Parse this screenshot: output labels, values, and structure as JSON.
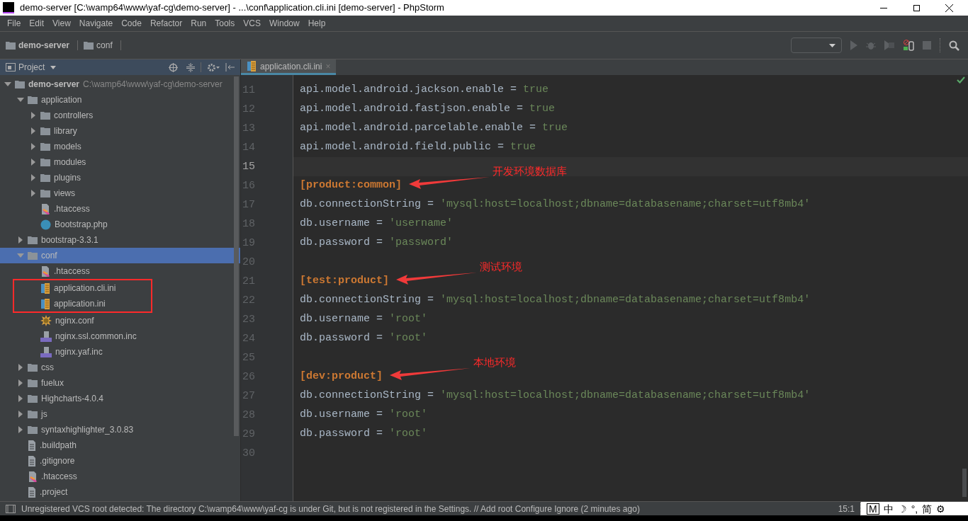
{
  "window": {
    "title": "demo-server [C:\\wamp64\\www\\yaf-cg\\demo-server] - ...\\conf\\application.cli.ini [demo-server] - PhpStorm"
  },
  "menu": [
    "File",
    "Edit",
    "View",
    "Navigate",
    "Code",
    "Refactor",
    "Run",
    "Tools",
    "VCS",
    "Window",
    "Help"
  ],
  "breadcrumbs": [
    {
      "label": "demo-server",
      "bold": true
    },
    {
      "label": "conf",
      "bold": false
    }
  ],
  "project_panel": {
    "title": "Project",
    "tree": [
      {
        "kind": "folder",
        "label": "demo-server",
        "path": "C:\\wamp64\\www\\yaf-cg\\demo-server",
        "expanded": true,
        "selected": false,
        "boxed": false,
        "children": [
          {
            "kind": "folder",
            "label": "application",
            "expanded": true,
            "selected": false,
            "boxed": false,
            "children": [
              {
                "kind": "folder",
                "label": "controllers",
                "expanded": false,
                "selected": false,
                "boxed": false
              },
              {
                "kind": "folder",
                "label": "library",
                "expanded": false,
                "selected": false,
                "boxed": false
              },
              {
                "kind": "folder",
                "label": "models",
                "expanded": false,
                "selected": false,
                "boxed": false
              },
              {
                "kind": "folder",
                "label": "modules",
                "expanded": false,
                "selected": false,
                "boxed": false
              },
              {
                "kind": "folder",
                "label": "plugins",
                "expanded": false,
                "selected": false,
                "boxed": false
              },
              {
                "kind": "folder",
                "label": "views",
                "expanded": false,
                "selected": false,
                "boxed": false
              },
              {
                "kind": "htaccess",
                "label": ".htaccess",
                "selected": false,
                "boxed": false
              },
              {
                "kind": "php-class",
                "label": "Bootstrap.php",
                "selected": false,
                "boxed": false
              }
            ]
          },
          {
            "kind": "folder",
            "label": "bootstrap-3.3.1",
            "expanded": false,
            "selected": false,
            "boxed": false
          },
          {
            "kind": "folder",
            "label": "conf",
            "expanded": true,
            "selected": true,
            "boxed": false,
            "children": [
              {
                "kind": "htaccess",
                "label": ".htaccess",
                "selected": false,
                "boxed": false
              },
              {
                "kind": "ini",
                "label": "application.cli.ini",
                "selected": false,
                "boxed": true
              },
              {
                "kind": "ini",
                "label": "application.ini",
                "selected": false,
                "boxed": true
              },
              {
                "kind": "conf",
                "label": "nginx.conf",
                "selected": false,
                "boxed": false
              },
              {
                "kind": "php-inc",
                "label": "nginx.ssl.common.inc",
                "selected": false,
                "boxed": false
              },
              {
                "kind": "php-inc",
                "label": "nginx.yaf.inc",
                "selected": false,
                "boxed": false
              }
            ]
          },
          {
            "kind": "folder",
            "label": "css",
            "expanded": false,
            "selected": false,
            "boxed": false
          },
          {
            "kind": "folder",
            "label": "fuelux",
            "expanded": false,
            "selected": false,
            "boxed": false
          },
          {
            "kind": "folder",
            "label": "Highcharts-4.0.4",
            "expanded": false,
            "selected": false,
            "boxed": false
          },
          {
            "kind": "folder",
            "label": "js",
            "expanded": false,
            "selected": false,
            "boxed": false
          },
          {
            "kind": "folder",
            "label": "syntaxhighlighter_3.0.83",
            "expanded": false,
            "selected": false,
            "boxed": false
          },
          {
            "kind": "text",
            "label": ".buildpath",
            "selected": false,
            "boxed": false
          },
          {
            "kind": "text",
            "label": ".gitignore",
            "selected": false,
            "boxed": false
          },
          {
            "kind": "htaccess",
            "label": ".htaccess",
            "selected": false,
            "boxed": false
          },
          {
            "kind": "text",
            "label": ".project",
            "selected": false,
            "boxed": false
          }
        ]
      }
    ]
  },
  "editor": {
    "tabs": [
      {
        "label": "application.cli.ini",
        "close": "×",
        "selected": true
      }
    ],
    "lines": [
      {
        "number": "11",
        "current": false,
        "segments": [
          {
            "kind": "key",
            "text": "api.model.android.jackson.enable = "
          },
          {
            "kind": "value",
            "text": "true"
          }
        ]
      },
      {
        "number": "12",
        "current": false,
        "segments": [
          {
            "kind": "key",
            "text": "api.model.android.fastjson.enable = "
          },
          {
            "kind": "value",
            "text": "true"
          }
        ]
      },
      {
        "number": "13",
        "current": false,
        "segments": [
          {
            "kind": "key",
            "text": "api.model.android.parcelable.enable = "
          },
          {
            "kind": "value",
            "text": "true"
          }
        ]
      },
      {
        "number": "14",
        "current": false,
        "segments": [
          {
            "kind": "key",
            "text": "api.model.android.field.public = "
          },
          {
            "kind": "value",
            "text": "true"
          }
        ]
      },
      {
        "number": "15",
        "current": true
      },
      {
        "number": "16",
        "current": false,
        "segments": [
          {
            "kind": "section",
            "text": "[product:common]"
          }
        ],
        "annotation": "开发环境数据库"
      },
      {
        "number": "17",
        "current": false,
        "segments": [
          {
            "kind": "key",
            "text": "db.connectionString = "
          },
          {
            "kind": "string",
            "text": "'mysql:host=localhost;dbname=databasename;charset=utf8mb4'"
          }
        ]
      },
      {
        "number": "18",
        "current": false,
        "segments": [
          {
            "kind": "key",
            "text": "db.username = "
          },
          {
            "kind": "string",
            "text": "'username'"
          }
        ]
      },
      {
        "number": "19",
        "current": false,
        "segments": [
          {
            "kind": "key",
            "text": "db.password = "
          },
          {
            "kind": "string",
            "text": "'password'"
          }
        ]
      },
      {
        "number": "20",
        "current": false
      },
      {
        "number": "21",
        "current": false,
        "segments": [
          {
            "kind": "section",
            "text": "[test:product]"
          }
        ],
        "annotation": "测试环境"
      },
      {
        "number": "22",
        "current": false,
        "segments": [
          {
            "kind": "key",
            "text": "db.connectionString = "
          },
          {
            "kind": "string",
            "text": "'mysql:host=localhost;dbname=databasename;charset=utf8mb4'"
          }
        ]
      },
      {
        "number": "23",
        "current": false,
        "segments": [
          {
            "kind": "key",
            "text": "db.username = "
          },
          {
            "kind": "string",
            "text": "'root'"
          }
        ]
      },
      {
        "number": "24",
        "current": false,
        "segments": [
          {
            "kind": "key",
            "text": "db.password = "
          },
          {
            "kind": "string",
            "text": "'root'"
          }
        ]
      },
      {
        "number": "25",
        "current": false
      },
      {
        "number": "26",
        "current": false,
        "segments": [
          {
            "kind": "section",
            "text": "[dev:product]"
          }
        ],
        "annotation": "本地环境"
      },
      {
        "number": "27",
        "current": false,
        "segments": [
          {
            "kind": "key",
            "text": "db.connectionString = "
          },
          {
            "kind": "string",
            "text": "'mysql:host=localhost;dbname=databasename;charset=utf8mb4'"
          }
        ]
      },
      {
        "number": "28",
        "current": false,
        "segments": [
          {
            "kind": "key",
            "text": "db.username = "
          },
          {
            "kind": "string",
            "text": "'root'"
          }
        ]
      },
      {
        "number": "29",
        "current": false,
        "segments": [
          {
            "kind": "key",
            "text": "db.password = "
          },
          {
            "kind": "string",
            "text": "'root'"
          }
        ]
      },
      {
        "number": "30",
        "current": false
      }
    ]
  },
  "status_bar": {
    "message": "Unregistered VCS root detected: The directory C:\\wamp64\\www\\yaf-cg is under Git, but is not registered in the Settings. // Add root  Configure  Ignore (2 minutes ago)",
    "position": "15:1"
  },
  "ime_bar": [
    "M",
    "中",
    "☽",
    "°,",
    "简",
    "⚙"
  ]
}
